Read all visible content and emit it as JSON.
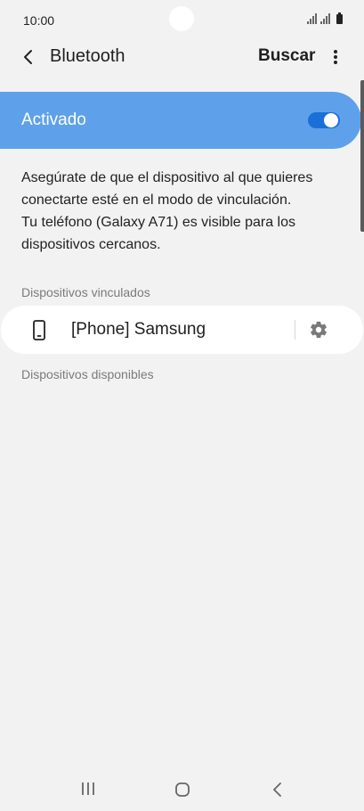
{
  "status_bar": {
    "time": "10:00",
    "icons": [
      "signal-icon",
      "signal-icon",
      "battery-icon"
    ]
  },
  "app_bar": {
    "title": "Bluetooth",
    "search_label": "Buscar",
    "back_icon": "chevron-left-icon",
    "more_icon": "more-vertical-icon"
  },
  "bluetooth_toggle": {
    "label": "Activado",
    "state": true,
    "accent_color": "#5ea1ea"
  },
  "description": {
    "lines": [
      "Asegúrate de que el dispositivo al que quieres",
      "conectarte esté en el modo de vinculación.",
      "Tu teléfono (Galaxy A71) es visible para los",
      "dispositivos cercanos."
    ]
  },
  "paired_devices": {
    "header": "Dispositivos vinculados",
    "items": [
      {
        "name": "[Phone] Samsung",
        "icon": "phone-icon",
        "settings_icon": "gear-icon"
      }
    ]
  },
  "available_devices": {
    "header": "Dispositivos disponibles"
  },
  "nav_bar": {
    "icons": [
      "recents-icon",
      "home-icon",
      "back-icon"
    ]
  }
}
